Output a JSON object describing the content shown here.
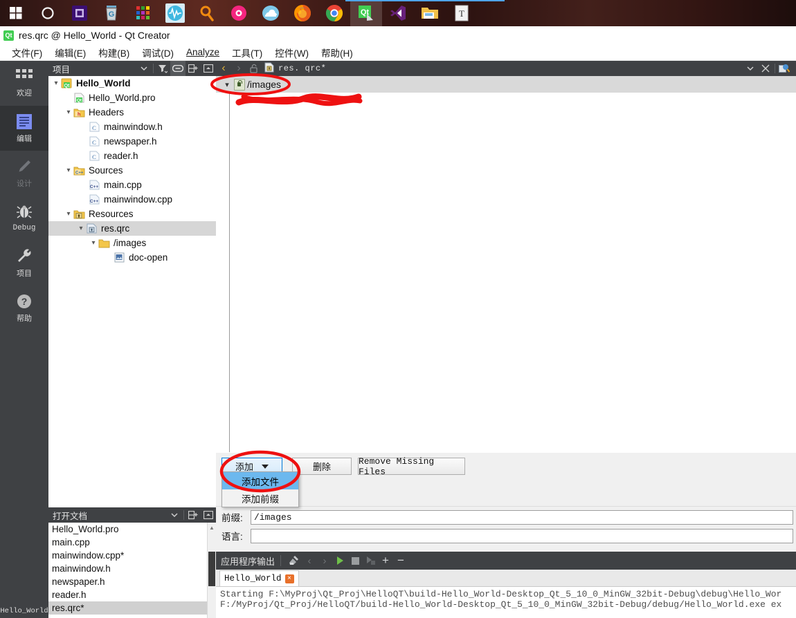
{
  "taskbar": {
    "items": [
      {
        "name": "windows-start-icon",
        "label": "Start"
      },
      {
        "name": "cortana-circle-icon",
        "label": "Cortana"
      },
      {
        "name": "cpu-chip-icon",
        "label": "CPU Monitor"
      },
      {
        "name": "geek-uninstaller-icon",
        "label": "Geek Uninstaller"
      },
      {
        "name": "colorful-squares-icon",
        "label": "App"
      },
      {
        "name": "waveform-icon",
        "label": "Audio"
      },
      {
        "name": "search-magnifier-icon",
        "label": "Everything"
      },
      {
        "name": "camera-pink-icon",
        "label": "Screen Recorder"
      },
      {
        "name": "cloud-icon",
        "label": "Cloud Drive"
      },
      {
        "name": "firefox-icon",
        "label": "Firefox"
      },
      {
        "name": "chrome-icon",
        "label": "Google Chrome"
      },
      {
        "name": "qt-creator-icon",
        "label": "Qt Creator"
      },
      {
        "name": "visual-studio-icon",
        "label": "Visual Studio"
      },
      {
        "name": "file-explorer-icon",
        "label": "File Explorer"
      },
      {
        "name": "text-editor-icon",
        "label": "Text Editor"
      }
    ]
  },
  "window": {
    "title": "res.qrc @ Hello_World - Qt Creator",
    "app_badge": "Qt"
  },
  "menubar": {
    "items": [
      {
        "text": "文件(F)",
        "mnemonic": "F"
      },
      {
        "text": "编辑(E)",
        "mnemonic": "E"
      },
      {
        "text": "构建(B)",
        "mnemonic": "B"
      },
      {
        "text": "调试(D)",
        "mnemonic": "D"
      },
      {
        "text": "Analyze",
        "mnemonic": "A"
      },
      {
        "text": "工具(T)",
        "mnemonic": "T"
      },
      {
        "text": "控件(W)",
        "mnemonic": "W"
      },
      {
        "text": "帮助(H)",
        "mnemonic": "H"
      }
    ]
  },
  "modebar": {
    "items": [
      {
        "label": "欢迎",
        "icon": "grid-squares-icon",
        "state": "normal"
      },
      {
        "label": "编辑",
        "icon": "document-lines-icon",
        "state": "selected"
      },
      {
        "label": "设计",
        "icon": "pencil-icon",
        "state": "disabled"
      },
      {
        "label": "Debug",
        "icon": "bug-icon",
        "state": "normal"
      },
      {
        "label": "项目",
        "icon": "wrench-icon",
        "state": "normal"
      },
      {
        "label": "帮助",
        "icon": "question-mark-icon",
        "state": "normal"
      }
    ]
  },
  "project_panel": {
    "title": "项目",
    "toolbar_icons": [
      "chevron-down-icon",
      "filter-icon",
      "link-icon",
      "split-add-icon",
      "minimize-icon"
    ],
    "tree": [
      {
        "depth": 0,
        "arrow": "down",
        "icon": "qt-project-icon",
        "name": "Hello_World",
        "bold": true,
        "selected": false
      },
      {
        "depth": 1,
        "arrow": "none",
        "icon": "pro-file-icon",
        "name": "Hello_World.pro",
        "bold": false,
        "selected": false
      },
      {
        "depth": 1,
        "arrow": "down",
        "icon": "headers-folder-icon",
        "name": "Headers",
        "bold": false,
        "selected": false
      },
      {
        "depth": 2,
        "arrow": "none",
        "icon": "h-file-icon",
        "name": "mainwindow.h",
        "bold": false,
        "selected": false
      },
      {
        "depth": 2,
        "arrow": "none",
        "icon": "h-file-icon",
        "name": "newspaper.h",
        "bold": false,
        "selected": false
      },
      {
        "depth": 2,
        "arrow": "none",
        "icon": "h-file-icon",
        "name": "reader.h",
        "bold": false,
        "selected": false
      },
      {
        "depth": 1,
        "arrow": "down",
        "icon": "sources-folder-icon",
        "name": "Sources",
        "bold": false,
        "selected": false
      },
      {
        "depth": 2,
        "arrow": "none",
        "icon": "cpp-file-icon",
        "name": "main.cpp",
        "bold": false,
        "selected": false
      },
      {
        "depth": 2,
        "arrow": "none",
        "icon": "cpp-file-icon",
        "name": "mainwindow.cpp",
        "bold": false,
        "selected": false
      },
      {
        "depth": 1,
        "arrow": "down",
        "icon": "resources-folder-icon",
        "name": "Resources",
        "bold": false,
        "selected": false
      },
      {
        "depth": 2,
        "arrow": "down",
        "icon": "qrc-file-icon",
        "name": "res.qrc",
        "bold": false,
        "selected": true
      },
      {
        "depth": 3,
        "arrow": "down",
        "icon": "folder-icon",
        "name": "/images",
        "bold": false,
        "selected": false
      },
      {
        "depth": 4,
        "arrow": "none",
        "icon": "image-file-icon",
        "name": "doc-open",
        "bold": false,
        "selected": false
      }
    ]
  },
  "open_documents": {
    "title": "打开文档",
    "toolbar_icons": [
      "chevron-down-icon",
      "split-add-icon",
      "minimize-icon"
    ],
    "items": [
      {
        "name": "Hello_World.pro",
        "selected": false
      },
      {
        "name": "main.cpp",
        "selected": false
      },
      {
        "name": "mainwindow.cpp*",
        "selected": false
      },
      {
        "name": "mainwindow.h",
        "selected": false
      },
      {
        "name": "newspaper.h",
        "selected": false
      },
      {
        "name": "reader.h",
        "selected": false
      },
      {
        "name": "res.qrc*",
        "selected": true
      }
    ]
  },
  "editor_toolbar": {
    "back_icon": "back-arrow-icon",
    "forward_icon": "forward-arrow-icon",
    "lock_icon": "unlocked-icon",
    "file_icon": "qrc-file-icon",
    "filename": "res. qrc*",
    "dropdown_icon": "chevron-down-icon",
    "close_icon": "close-x-icon",
    "split_icon": "split-editor-icon"
  },
  "resource_editor": {
    "rows": [
      {
        "arrow": "down",
        "icon": "qrc-prefix-icon",
        "label": "/images",
        "selected": true
      }
    ]
  },
  "buttons": {
    "add": "添加",
    "remove": "删除",
    "remove_missing": "Remove Missing Files"
  },
  "dropdown_menu": {
    "items": [
      {
        "label": "添加文件",
        "highlighted": true
      },
      {
        "label": "添加前缀",
        "highlighted": false
      }
    ]
  },
  "fields": {
    "prefix_label": "前缀:",
    "prefix_value": "/images",
    "language_label": "语言:",
    "language_value": ""
  },
  "output_pane": {
    "title": "应用程序输出",
    "toolbar_icons": [
      "clear-broom-icon",
      "prev-arrow-icon",
      "next-arrow-icon",
      "run-play-icon",
      "stop-square-icon",
      "attach-debug-icon",
      "plus-icon",
      "minus-icon"
    ],
    "tab_label": "Hello_World",
    "tab_close": "×",
    "lines": [
      "Starting F:\\MyProj\\Qt_Proj\\HelloQT\\build-Hello_World-Desktop_Qt_5_10_0_MinGW_32bit-Debug\\debug\\Hello_Wor",
      "F:/MyProj/Qt_Proj/HelloQT/build-Hello_World-Desktop_Qt_5_10_0_MinGW_32bit-Debug/debug/Hello_World.exe ex"
    ]
  },
  "status_bar": {
    "project": "Hello_World"
  },
  "colors": {
    "dark_chrome": "#3f4144",
    "mode_selected": "#313335",
    "accent_blue": "#0078d7",
    "highlight_blue": "#6cb8ee",
    "qt_green": "#41cd52",
    "annotation_red": "#ee1111",
    "selection_gray": "#d6d6d6"
  }
}
